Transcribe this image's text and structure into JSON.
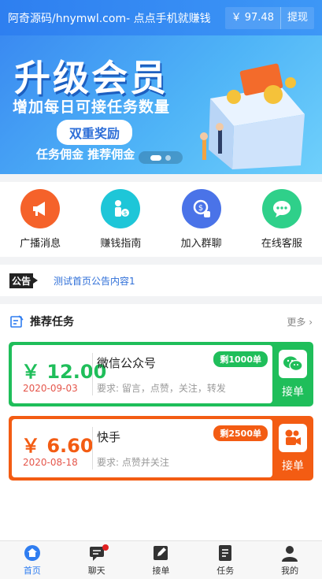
{
  "header": {
    "title": "阿奇源码/hnymwl.com- 点点手机就赚钱",
    "balance": "￥ 97.48",
    "withdraw_label": "提现"
  },
  "banner": {
    "headline": "升级会员",
    "subline": "增加每日可接任务数量",
    "pill": "双重奖励",
    "bottom_text": "任务佣金  推荐佣金",
    "slide_count": 2,
    "active_slide": 1
  },
  "menu": [
    {
      "label": "广播消息",
      "icon": "megaphone-icon",
      "color": "#f5622a"
    },
    {
      "label": "赚钱指南",
      "icon": "money-guide-icon",
      "color": "#1ec6d8"
    },
    {
      "label": "加入群聊",
      "icon": "group-chat-icon",
      "color": "#4a73e8"
    },
    {
      "label": "在线客服",
      "icon": "chat-bubble-icon",
      "color": "#2fd08a"
    }
  ],
  "notice": {
    "tag": "公告",
    "text": "测试首页公告内容1"
  },
  "tasks": {
    "title": "推荐任务",
    "more_label": "更多 ›",
    "items": [
      {
        "price": "￥ 12.00",
        "date": "2020-09-03",
        "name": "微信公众号",
        "requirement": "要求: 留言，点赞，关注，转发",
        "remaining": "剩1000单",
        "accept_label": "接单",
        "platform_icon": "wechat-icon",
        "color": "#1fbe5a"
      },
      {
        "price": "￥ 6.60",
        "date": "2020-08-18",
        "name": "快手",
        "requirement": "要求: 点赞并关注",
        "remaining": "剩2500单",
        "accept_label": "接单",
        "platform_icon": "kuaishou-icon",
        "color": "#f35c13"
      }
    ]
  },
  "tabbar": [
    {
      "label": "首页",
      "icon": "home-icon",
      "active": true
    },
    {
      "label": "聊天",
      "icon": "chat-icon",
      "active": false,
      "badge": true
    },
    {
      "label": "接单",
      "icon": "edit-icon",
      "active": false
    },
    {
      "label": "任务",
      "icon": "task-list-icon",
      "active": false
    },
    {
      "label": "我的",
      "icon": "user-icon",
      "active": false
    }
  ]
}
